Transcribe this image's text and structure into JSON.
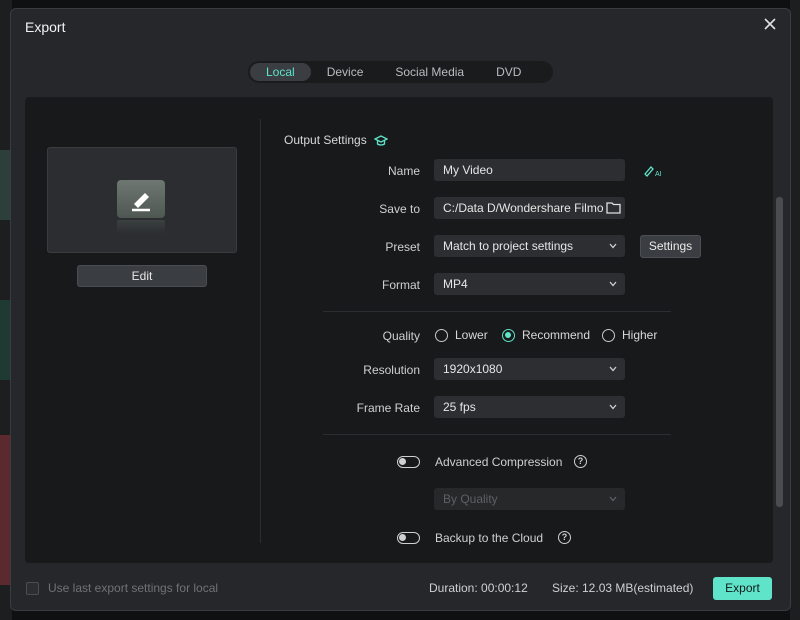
{
  "dialog": {
    "title": "Export"
  },
  "tabs": [
    {
      "label": "Local"
    },
    {
      "label": "Device"
    },
    {
      "label": "Social Media"
    },
    {
      "label": "DVD"
    }
  ],
  "preview": {
    "edit_label": "Edit"
  },
  "output": {
    "section_title": "Output Settings",
    "name_label": "Name",
    "name_value": "My Video",
    "save_label": "Save to",
    "save_value": "C:/Data D/Wondershare Filmo",
    "preset_label": "Preset",
    "preset_value": "Match to project settings",
    "settings_label": "Settings",
    "format_label": "Format",
    "format_value": "MP4",
    "quality_label": "Quality",
    "quality_options": [
      "Lower",
      "Recommend",
      "Higher"
    ],
    "quality_selected": "Recommend",
    "resolution_label": "Resolution",
    "resolution_value": "1920x1080",
    "framerate_label": "Frame Rate",
    "framerate_value": "25 fps",
    "adv_compression_label": "Advanced Compression",
    "compression_mode": "By Quality",
    "backup_label": "Backup to the Cloud"
  },
  "footer": {
    "use_last_label": "Use last export settings for local",
    "duration": "Duration: 00:00:12",
    "size": "Size: 12.03 MB(estimated)",
    "export_label": "Export"
  },
  "colors": {
    "accent": "#5fe3c9",
    "bg": "#25272a",
    "panel": "#18191b"
  }
}
